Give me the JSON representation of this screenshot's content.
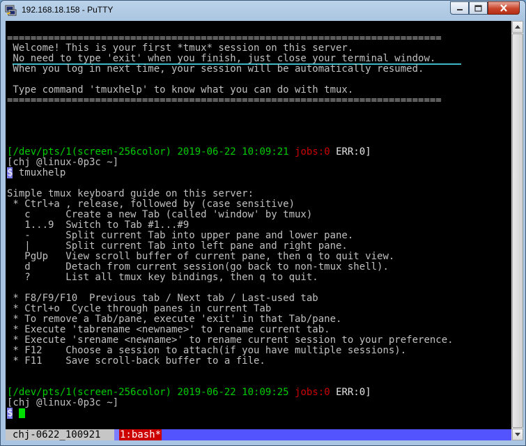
{
  "window": {
    "title": "192.168.18.158 - PuTTY"
  },
  "icons": {
    "app": "putty-icon",
    "minimize": "minimize-icon",
    "maximize": "maximize-icon",
    "close": "close-icon"
  },
  "banner": {
    "rule": "==========================================================================",
    "line1": " Welcome! This is your first *tmux* session on this server.",
    "line2": " No need to type 'exit' when you finish, just close your terminal window.",
    "line3": " When you log in next time, your session will be automatically resumed.",
    "line4": " Type command 'tmuxhelp' to know what you can do with tmux."
  },
  "prompt1": {
    "open": "[",
    "tty": "/dev/pts/1(screen-256color)",
    "datetime": "2019-06-22 10:09:21",
    "jobs": "jobs:0",
    "err": "ERR:0",
    "close": "]",
    "userhost": "[chj @linux-0p3c ~]",
    "dollar": "$",
    "command": " tmuxhelp"
  },
  "help": {
    "heading": "Simple tmux keyboard guide on this server:",
    "lines": [
      " * Ctrl+a , release, followed by (case sensitive)",
      "   c      Create a new Tab (called 'window' by tmux)",
      "   1...9  Switch to Tab #1...#9",
      "   -      Split current Tab into upper pane and lower pane.",
      "   |      Split current Tab into left pane and right pane.",
      "   PgUp   View scroll buffer of current pane, then q to quit view.",
      "   d      Detach from current session(go back to non-tmux shell).",
      "   ?      List all tmux key bindings, then q to quit.",
      "",
      " * F8/F9/F10  Previous tab / Next tab / Last-used tab",
      " * Ctrl+o  Cycle through panes in current Tab",
      " * To remove a Tab/pane, execute 'exit' in that Tab/pane.",
      " * Execute 'tabrename <newname>' to rename current tab.",
      " * Execute 'srename <newname>' to rename current session to your preference.",
      " * F12    Choose a session to attach(if you have multiple sessions).",
      " * F11    Save scroll-back buffer to a file."
    ]
  },
  "prompt2": {
    "open": "[",
    "tty": "/dev/pts/1(screen-256color)",
    "datetime": "2019-06-22 10:09:25",
    "jobs": "jobs:0",
    "err": "ERR:0",
    "close": "]",
    "userhost": "[chj @linux-0p3c ~]",
    "dollar": "$"
  },
  "statusbar": {
    "session": "chj-0622_100921",
    "active_window": "1:bash*"
  },
  "colors": {
    "background": "#000000",
    "foreground": "#c0c0c0",
    "green": "#00cd00",
    "red": "#cd0000",
    "statusbar": "#5454ff"
  }
}
